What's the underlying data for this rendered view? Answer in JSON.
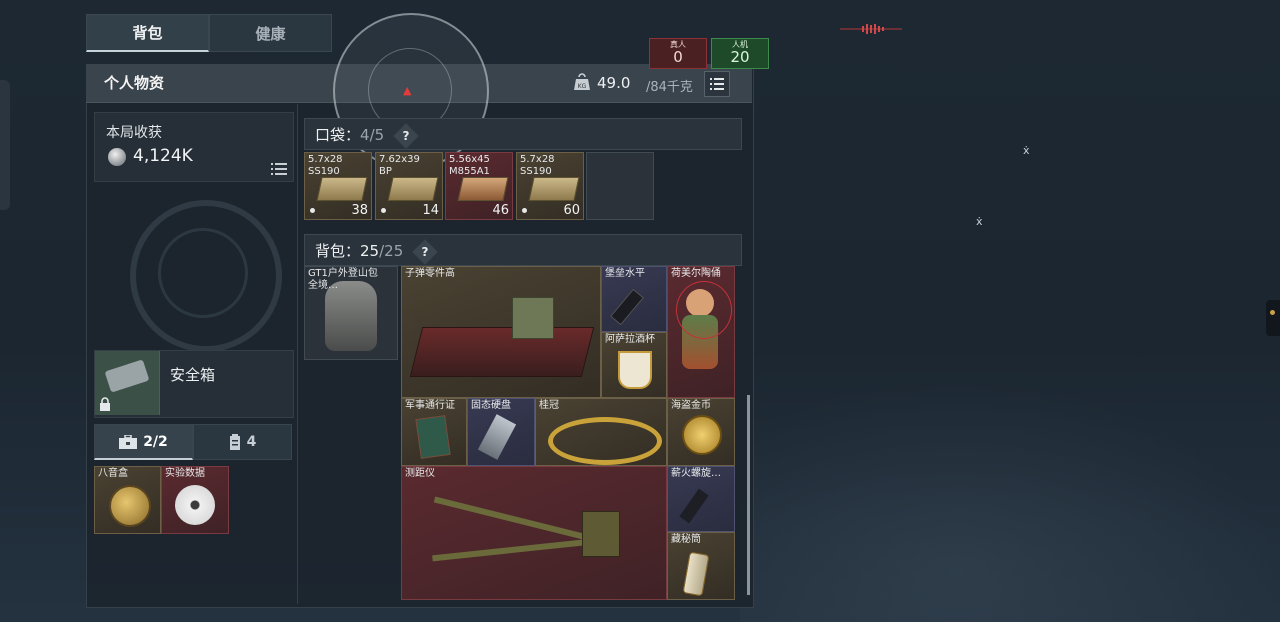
{
  "tabs": [
    {
      "label": "背包",
      "active": true
    },
    {
      "label": "健康",
      "active": false
    }
  ],
  "header": {
    "title": "个人物资",
    "weight_current": "49.0",
    "weight_max": "/84千克",
    "weight_icon": "kg-weight-icon",
    "list_icon": "list-icon"
  },
  "counters": {
    "real": {
      "label": "真人",
      "value": "0"
    },
    "bot": {
      "label": "人机",
      "value": "20"
    }
  },
  "earnings": {
    "label": "本局收获",
    "value": "4,124K",
    "icon": "silver-coin-icon"
  },
  "safebox": {
    "label": "安全箱",
    "icon": "lock-icon"
  },
  "mini_tabs": [
    {
      "label": "2/2",
      "icon": "briefcase-icon",
      "active": true
    },
    {
      "label": "4",
      "icon": "canister-icon",
      "active": false
    }
  ],
  "safe_items": [
    {
      "name": "八音盒",
      "rarity": "gold"
    },
    {
      "name": "实验数据",
      "rarity": "red"
    }
  ],
  "pocket": {
    "label": "口袋：",
    "used": "4",
    "total": "/5",
    "help": "?",
    "items": [
      {
        "name": "5.7x28\nSS190",
        "count": "38",
        "rarity": "gold"
      },
      {
        "name": "7.62x39\nBP",
        "count": "14",
        "rarity": "gold"
      },
      {
        "name": "5.56x45\nM855A1",
        "count": "46",
        "rarity": "red"
      },
      {
        "name": "5.7x28\nSS190",
        "count": "60",
        "rarity": "gold"
      },
      {
        "name": "",
        "count": "",
        "rarity": "empty"
      }
    ]
  },
  "backpack": {
    "label": "背包：",
    "used": "25",
    "total": "/25",
    "help": "?",
    "bag_name": "GT1户外登山包\n全境…",
    "items": [
      {
        "name": "子弹零件高",
        "rarity": "gold"
      },
      {
        "name": "堡垒水平",
        "rarity": "purple"
      },
      {
        "name": "荷美尔陶俑",
        "rarity": "red"
      },
      {
        "name": "阿萨拉酒杯",
        "rarity": "gold"
      },
      {
        "name": "军事通行证",
        "rarity": "gold"
      },
      {
        "name": "固态硬盘",
        "rarity": "purple"
      },
      {
        "name": "桂冠",
        "rarity": "gold"
      },
      {
        "name": "海盗金币",
        "rarity": "gold"
      },
      {
        "name": "测距仪",
        "rarity": "red"
      },
      {
        "name": "薪火螺旋…",
        "rarity": "purple"
      },
      {
        "name": "藏秘筒",
        "rarity": "gold"
      }
    ]
  },
  "colors": {
    "gold": "#4a4232",
    "red": "#5a2a2f",
    "purple": "#373a52",
    "accent_green": "#3c8a4c",
    "accent_red": "#8a3236"
  }
}
